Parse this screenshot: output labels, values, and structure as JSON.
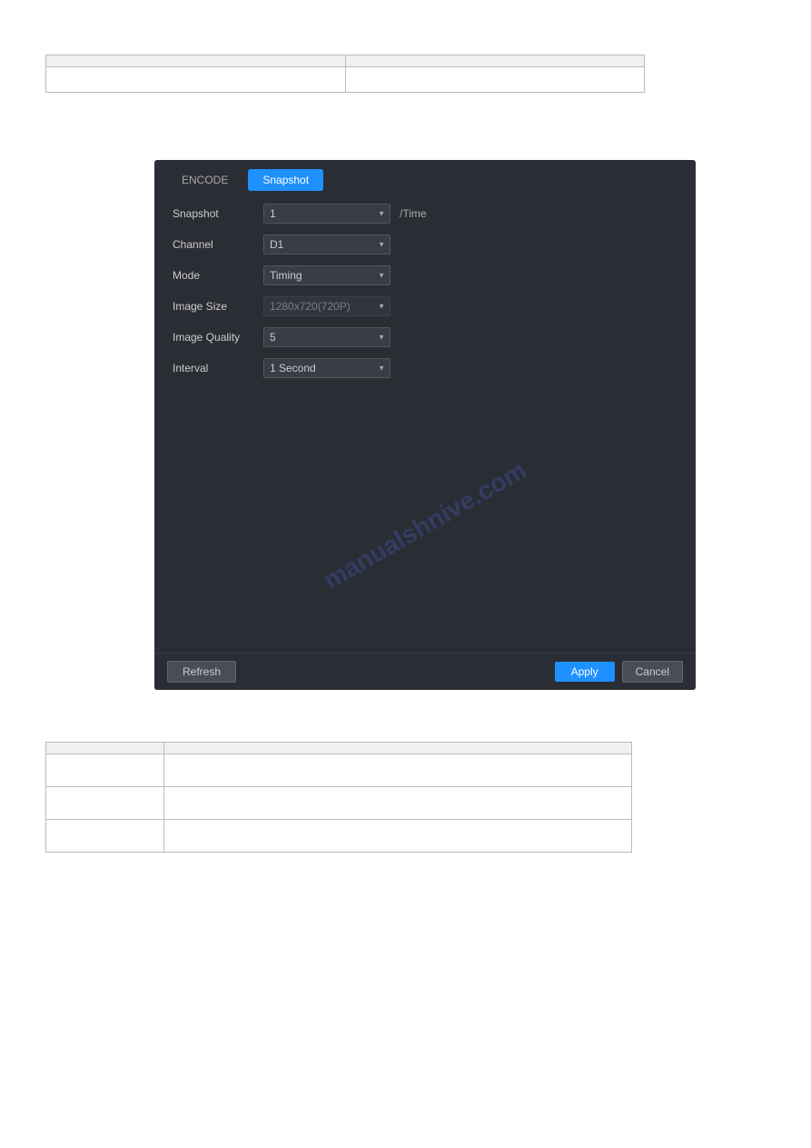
{
  "top_table": {
    "headers": [
      "",
      ""
    ],
    "rows": [
      [
        "",
        ""
      ]
    ]
  },
  "links": {
    "link1": "",
    "link2": "",
    "link3": ""
  },
  "panel": {
    "tab_encode": "ENCODE",
    "tab_snapshot": "Snapshot",
    "fields": {
      "snapshot_label": "Snapshot",
      "snapshot_value": "1",
      "snapshot_unit": "/Time",
      "channel_label": "Channel",
      "channel_value": "D1",
      "mode_label": "Mode",
      "mode_value": "Timing",
      "image_size_label": "Image Size",
      "image_size_value": "1280x720(720P)",
      "image_quality_label": "Image Quality",
      "image_quality_value": "5",
      "interval_label": "Interval",
      "interval_value": "1 Second"
    },
    "buttons": {
      "refresh": "Refresh",
      "apply": "Apply",
      "cancel": "Cancel"
    }
  },
  "watermark": "manualshnive.com",
  "bottom_table": {
    "header": [
      "",
      ""
    ],
    "rows": [
      [
        "",
        ""
      ],
      [
        "",
        ""
      ],
      [
        "",
        ""
      ]
    ]
  }
}
